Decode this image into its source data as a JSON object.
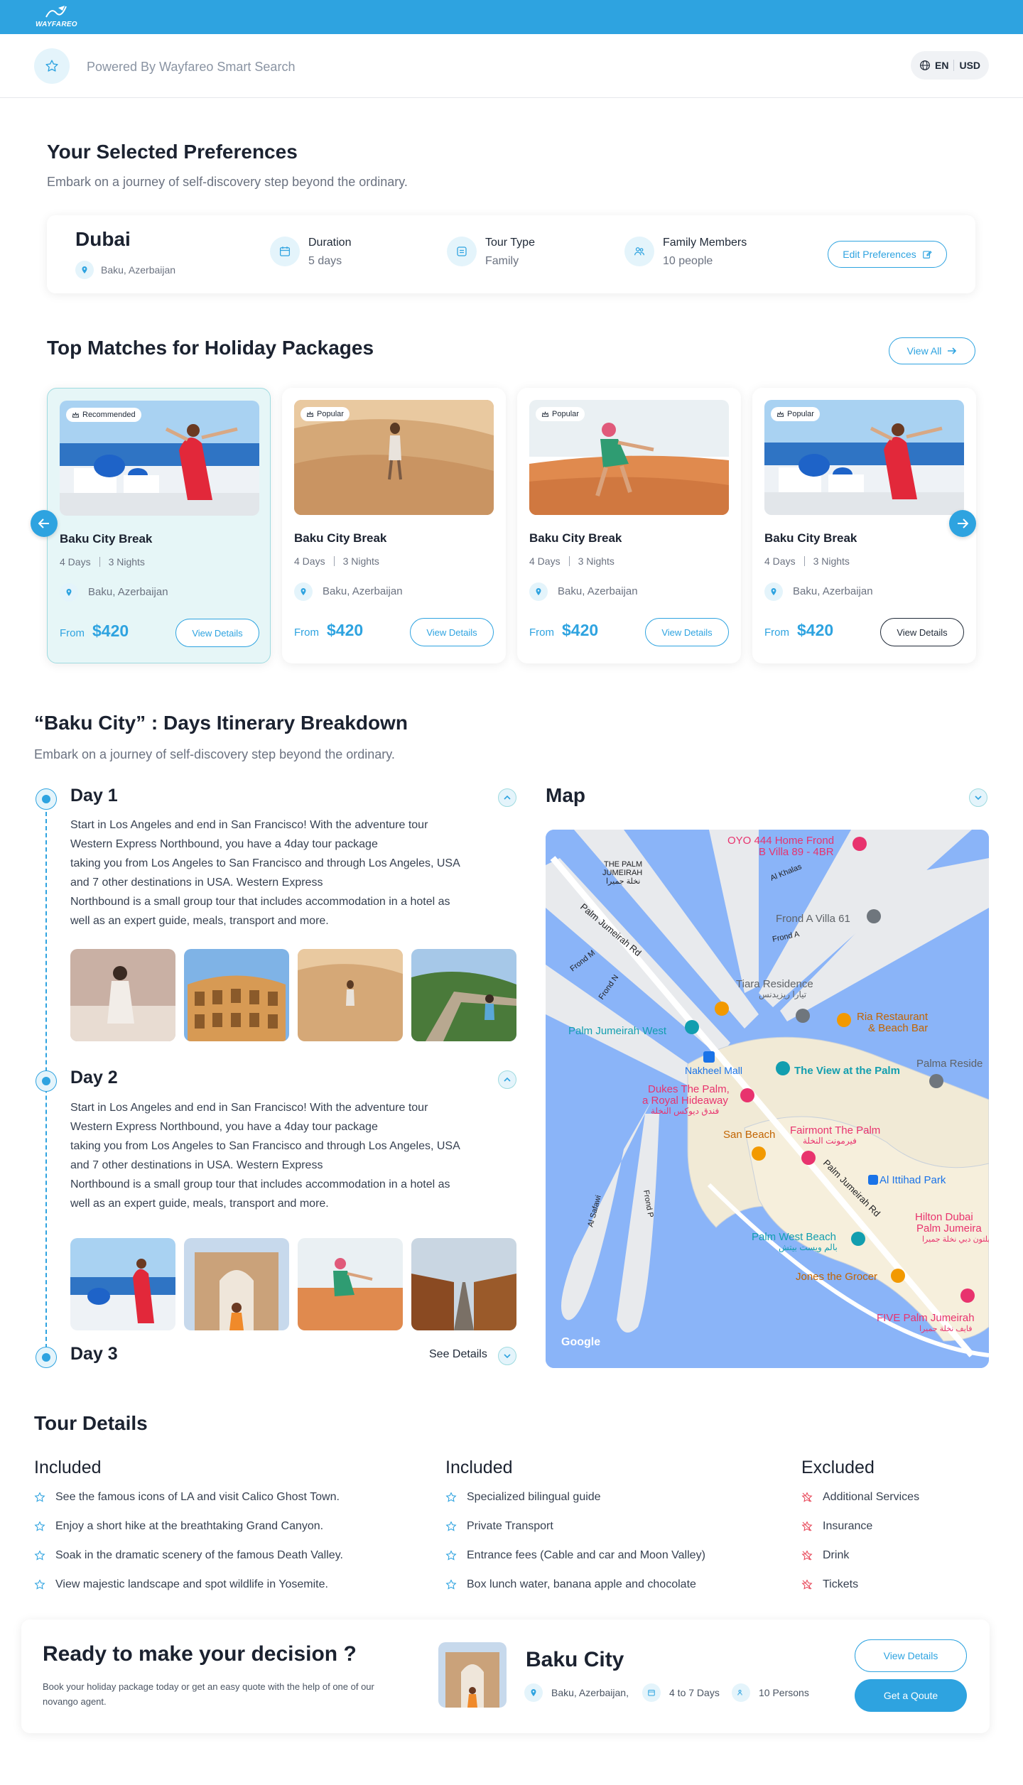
{
  "brand": {
    "name": "WAYFAREO"
  },
  "header": {
    "powered_by": "Powered By Wayfareo Smart Search",
    "language": "EN",
    "currency": "USD"
  },
  "preferences": {
    "title": "Your Selected Preferences",
    "subtitle": "Embark on a journey of self-discovery  step beyond the ordinary.",
    "destination": "Dubai",
    "origin": "Baku, Azerbaijan",
    "duration_label": "Duration",
    "duration_value": "5 days",
    "tour_type_label": "Tour Type",
    "tour_type_value": "Family",
    "members_label": "Family Members",
    "members_value": "10 people",
    "edit_label": "Edit Preferences"
  },
  "packages_section": {
    "title": "Top Matches for Holiday Packages",
    "view_all": "View All",
    "packages": [
      {
        "badge": "Recommended",
        "title": "Baku City Break",
        "days": "4 Days",
        "nights": "3 Nights",
        "location": "Baku, Azerbaijan",
        "from": "From",
        "price": "$420",
        "button": "View Details",
        "image": "santorini"
      },
      {
        "badge": "Popular",
        "title": "Baku City Break",
        "days": "4 Days",
        "nights": "3 Nights",
        "location": "Baku, Azerbaijan",
        "from": "From",
        "price": "$420",
        "button": "View Details",
        "image": "desert-walker"
      },
      {
        "badge": "Popular",
        "title": "Baku City Break",
        "days": "4 Days",
        "nights": "3 Nights",
        "location": "Baku, Azerbaijan",
        "from": "From",
        "price": "$420",
        "button": "View Details",
        "image": "desert-sand"
      },
      {
        "badge": "Popular",
        "title": "Baku City Break",
        "days": "4 Days",
        "nights": "3 Nights",
        "location": "Baku, Azerbaijan",
        "from": "From",
        "price": "$420",
        "button": "View Details",
        "image": "santorini"
      }
    ]
  },
  "itinerary": {
    "title": "“Baku City” : Days Itinerary Breakdown",
    "subtitle": "Embark on a journey of self-discovery  step beyond the ordinary.",
    "days": [
      {
        "title": "Day 1",
        "lines": [
          "Start in Los Angeles and end in San Francisco! With the adventure tour",
          "Western Express Northbound, you have a 4day tour package",
          "taking you from Los Angeles to San Francisco and through Los Angeles, USA",
          "and 7 other destinations in USA. Western Express",
          "Northbound is a small group tour that includes accommodation in a hotel as",
          "well as an expert guide, meals, transport and more."
        ]
      },
      {
        "title": "Day 2",
        "lines": [
          "Start in Los Angeles and end in San Francisco! With the adventure tour",
          "Western Express Northbound, you have a 4day tour package",
          "taking you from Los Angeles to San Francisco and through Los Angeles, USA",
          "and 7 other destinations in USA. Western Express",
          "Northbound is a small group tour that includes accommodation in a hotel as",
          "well as an expert guide, meals, transport and more."
        ]
      },
      {
        "title": "Day 3",
        "see_details": "See Details"
      }
    ]
  },
  "map": {
    "title": "Map",
    "labels": {
      "oyo": "OYO 444 Home Frond",
      "oyo2": "B Villa 89 - 4BR",
      "palm_j": "THE PALM",
      "palm_j2": "JUMEIRAH",
      "palm_j_ar": "نخلة جميرا",
      "al_khalas": "Al Khalas",
      "frond_a_villa": "Frond A Villa 61",
      "frond_a": "Frond A",
      "palm_rd": "Palm Jumeirah Rd",
      "frond_m": "Frond M",
      "frond_n": "Frond N",
      "tiara": "Tiara Residence",
      "tiara_ar": "تيارا ريزيدنس",
      "ria": "Ria Restaurant",
      "ria2": "& Beach Bar",
      "pj_west": "Palm Jumeirah West",
      "nakheel": "Nakheel Mall",
      "view": "The View at the Palm",
      "palma": "Palma Reside",
      "dukes": "Dukes The Palm,",
      "dukes2": "a Royal Hideaway",
      "dukes_ar": "فندق ديوكس النخلة",
      "san_beach": "San Beach",
      "fairmont": "Fairmont The Palm",
      "fairmont_ar": "فيرمونت النخلة",
      "al_ittihad": "Al Ittihad Park",
      "al_safawi": "Al Safawi",
      "frond_p": "Frond P",
      "pj_rd2": "Palm Jumeirah Rd",
      "hilton": "Hilton Dubai",
      "hilton2": "Palm Jumeira",
      "hilton_ar": "هيلتون دبي نخلة جميرا",
      "pw_beach": "Palm West Beach",
      "pw_beach_ar": "بالم ويست بيتش",
      "jones": "Jones the Grocer",
      "five": "FIVE Palm Jumeirah",
      "five_ar": "فايف نخلة جميرا",
      "google": "Google"
    }
  },
  "tour_details": {
    "title": "Tour Details",
    "included_a": {
      "title": "Included",
      "items": [
        "See the famous icons of LA and visit Calico Ghost Town.",
        "Enjoy a short hike at the breathtaking Grand Canyon.",
        "Soak in the dramatic scenery of the famous Death Valley.",
        "View majestic landscape and spot wildlife in Yosemite."
      ]
    },
    "included_b": {
      "title": "Included",
      "items": [
        "Specialized bilingual guide",
        "Private Transport",
        "Entrance fees (Cable and car and Moon Valley)",
        "Box lunch water, banana apple and chocolate"
      ]
    },
    "excluded": {
      "title": "Excluded",
      "items": [
        "Additional Services",
        "Insurance",
        "Drink",
        "Tickets"
      ]
    }
  },
  "decision": {
    "title": "Ready to make your decision ?",
    "subtitle": "Book your holiday package today or get an easy quote with the help of one of our novango agent.",
    "city": "Baku City",
    "location": "Baku, Azerbaijan,",
    "duration": "4 to 7 Days",
    "persons": "10 Persons",
    "view_details": "View Details",
    "get_quote": "Get a Qoute"
  },
  "colors": {
    "brand_blue": "#2ea3e0",
    "soft_teal": "#e4f4fb",
    "active_card": "#e6f6f7"
  }
}
